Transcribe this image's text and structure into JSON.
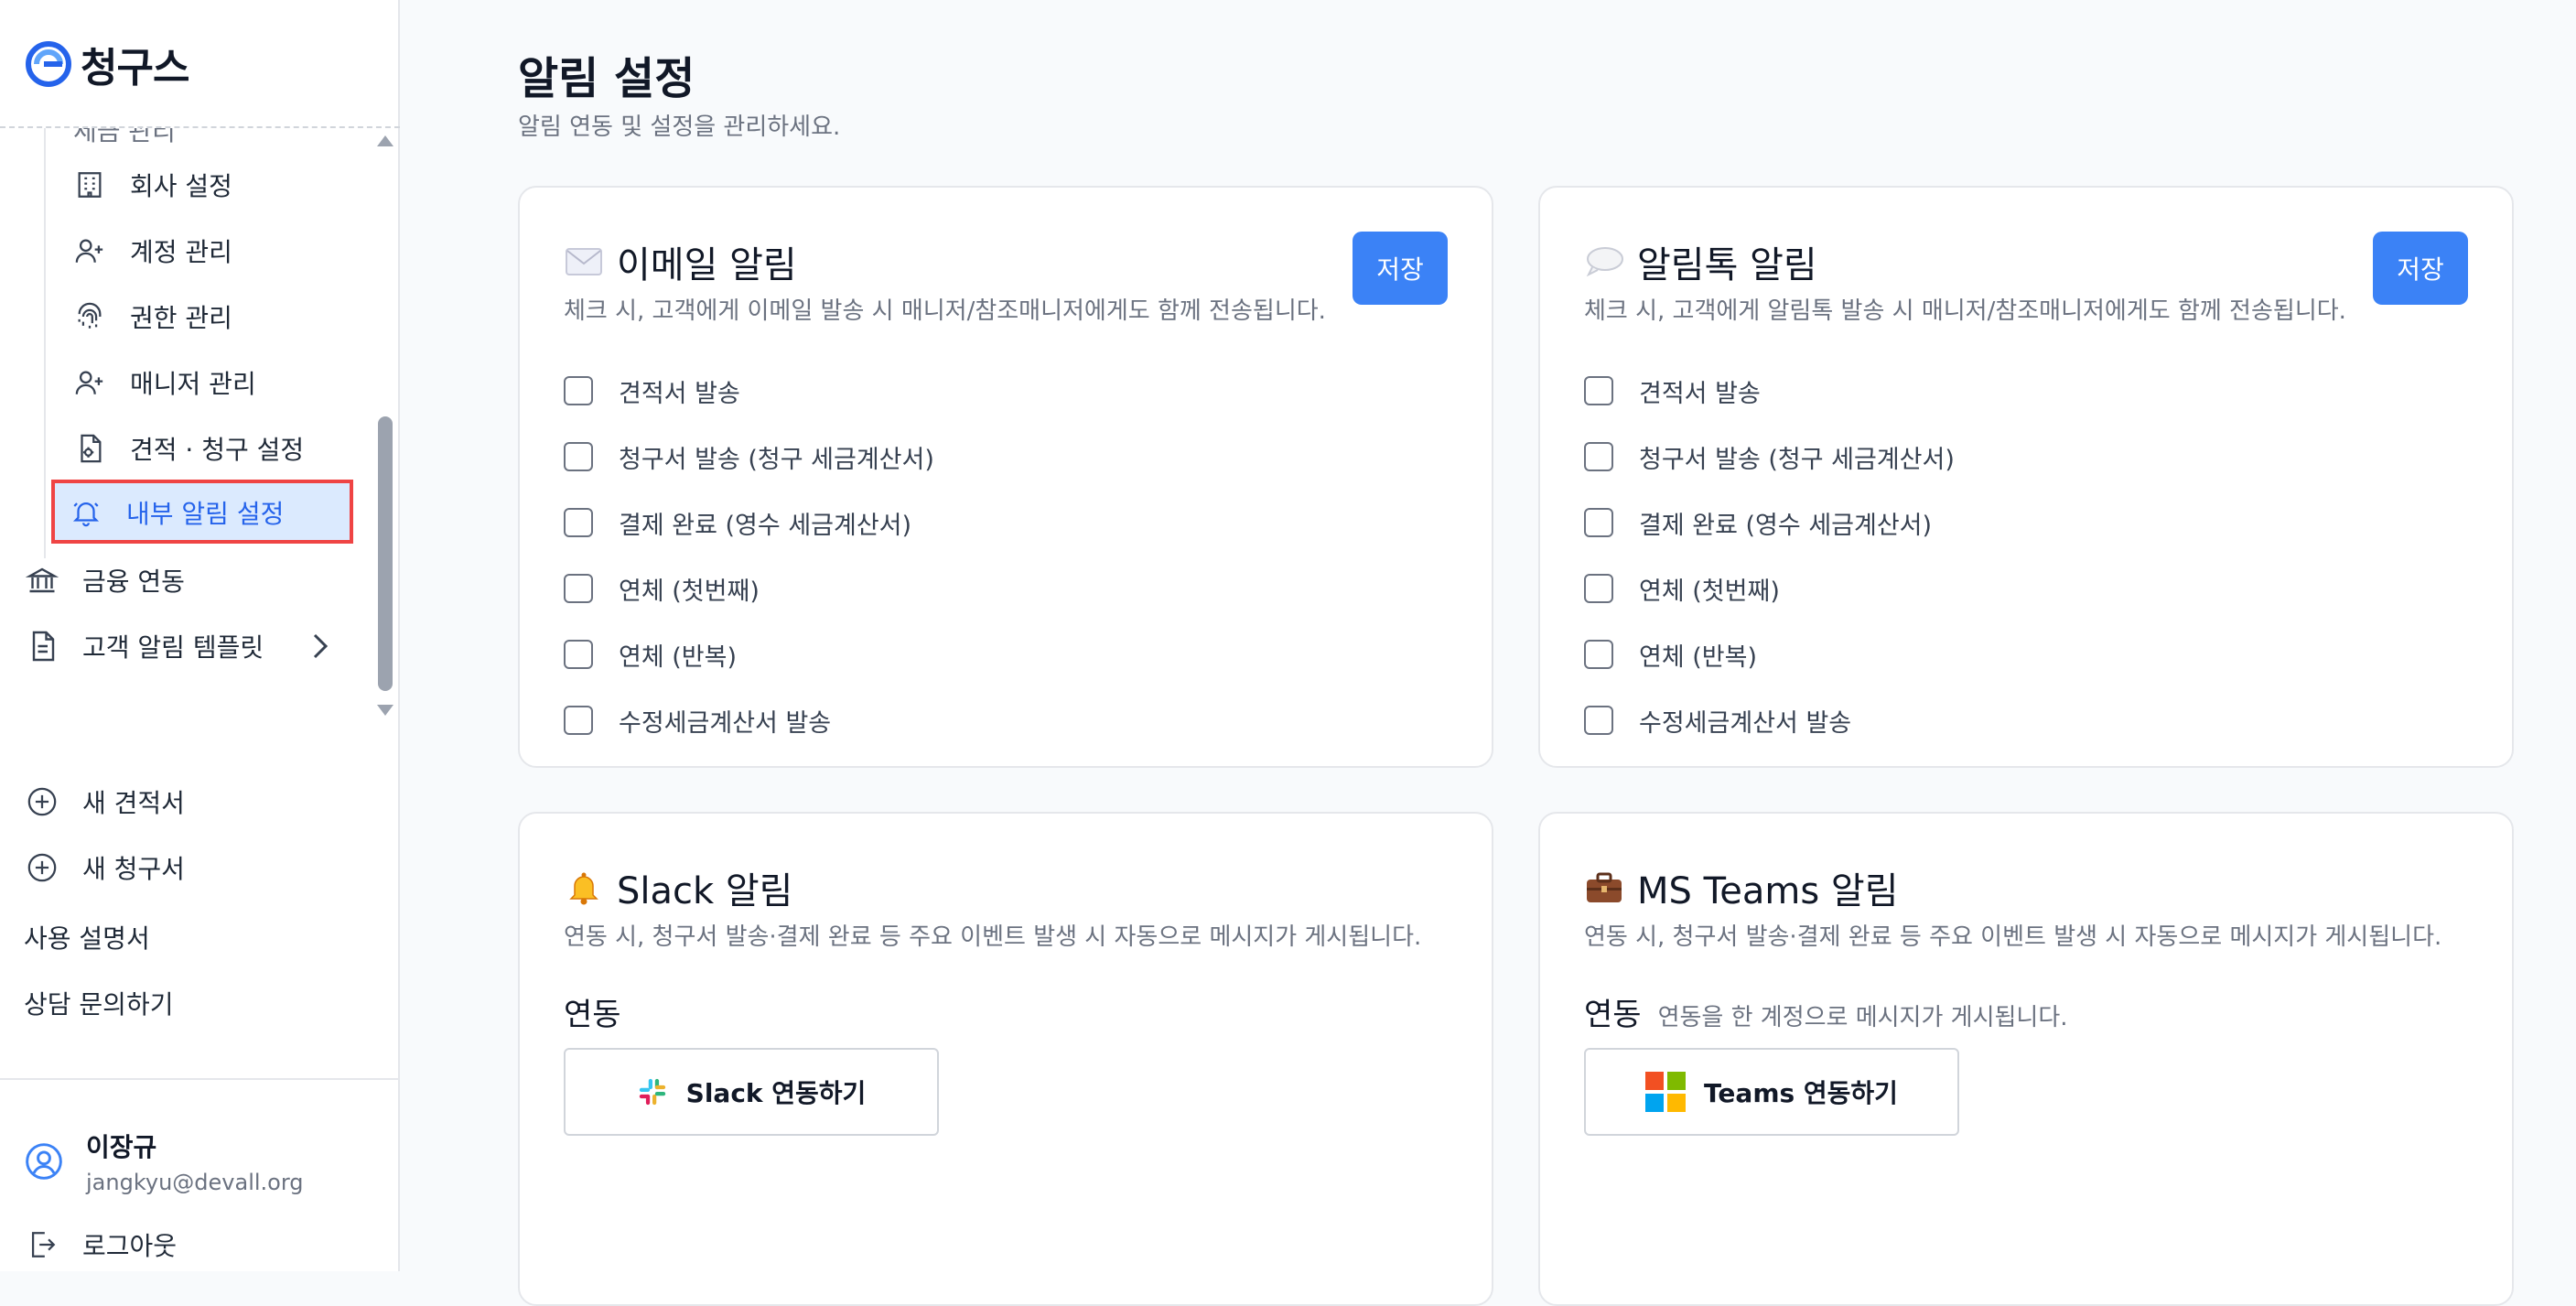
{
  "app": {
    "name": "청구스"
  },
  "sidebar": {
    "partial_item": "세금 관리",
    "sub_items": [
      {
        "label": "회사 설정",
        "icon": "building-icon"
      },
      {
        "label": "계정 관리",
        "icon": "user-plus-icon"
      },
      {
        "label": "권한 관리",
        "icon": "fingerprint-icon"
      },
      {
        "label": "매니저 관리",
        "icon": "user-plus-icon"
      },
      {
        "label": "견적 · 청구 설정",
        "icon": "file-gear-icon"
      },
      {
        "label": "내부 알림 설정",
        "icon": "bell-icon"
      }
    ],
    "top_items": [
      {
        "label": "금융 연동",
        "icon": "bank-icon"
      },
      {
        "label": "고객 알림 템플릿",
        "icon": "document-icon"
      }
    ],
    "actions": [
      {
        "label": "새 견적서",
        "icon": "plus-circle-icon"
      },
      {
        "label": "새 청구서",
        "icon": "plus-circle-icon"
      }
    ],
    "links": [
      "사용 설명서",
      "상담 문의하기"
    ],
    "user": {
      "name": "이장규",
      "email": "jangkyu@devall.org"
    },
    "logout": "로그아웃"
  },
  "page": {
    "title": "알림 설정",
    "subtitle": "알림 연동 및 설정을 관리하세요."
  },
  "email_card": {
    "title": "이메일 알림",
    "icon": "envelope-icon",
    "description": "체크 시, 고객에게 이메일 발송 시 매니저/참조매니저에게도 함께 전송됩니다.",
    "save": "저장",
    "options": [
      {
        "label": "견적서 발송",
        "checked": false
      },
      {
        "label": "청구서 발송 (청구 세금계산서)",
        "checked": false
      },
      {
        "label": "결제 완료 (영수 세금계산서)",
        "checked": false
      },
      {
        "label": "연체 (첫번째)",
        "checked": false
      },
      {
        "label": "연체 (반복)",
        "checked": false
      },
      {
        "label": "수정세금계산서 발송",
        "checked": false
      }
    ]
  },
  "kakao_card": {
    "title": "알림톡 알림",
    "icon": "speech-bubble-icon",
    "description": "체크 시, 고객에게 알림톡 발송 시 매니저/참조매니저에게도 함께 전송됩니다.",
    "save": "저장",
    "options": [
      {
        "label": "견적서 발송",
        "checked": false
      },
      {
        "label": "청구서 발송 (청구 세금계산서)",
        "checked": false
      },
      {
        "label": "결제 완료 (영수 세금계산서)",
        "checked": false
      },
      {
        "label": "연체 (첫번째)",
        "checked": false
      },
      {
        "label": "연체 (반복)",
        "checked": false
      },
      {
        "label": "수정세금계산서 발송",
        "checked": false
      }
    ]
  },
  "slack_card": {
    "title": "Slack 알림",
    "icon": "bell-emoji-icon",
    "description": "연동 시, 청구서 발송·결제 완료 등 주요 이벤트 발생 시 자동으로 메시지가 게시됩니다.",
    "section": "연동",
    "button": "Slack 연동하기"
  },
  "teams_card": {
    "title": "MS Teams 알림",
    "icon": "briefcase-icon",
    "description": "연동 시, 청구서 발송·결제 완료 등 주요 이벤트 발생 시 자동으로 메시지가 게시됩니다.",
    "section": "연동",
    "hint": "연동을 한 계정으로 메시지가 게시됩니다.",
    "button": "Teams 연동하기"
  },
  "colors": {
    "accent": "#3b82f6",
    "active_bg": "#dbeafe",
    "highlight_border": "#ef4444"
  }
}
